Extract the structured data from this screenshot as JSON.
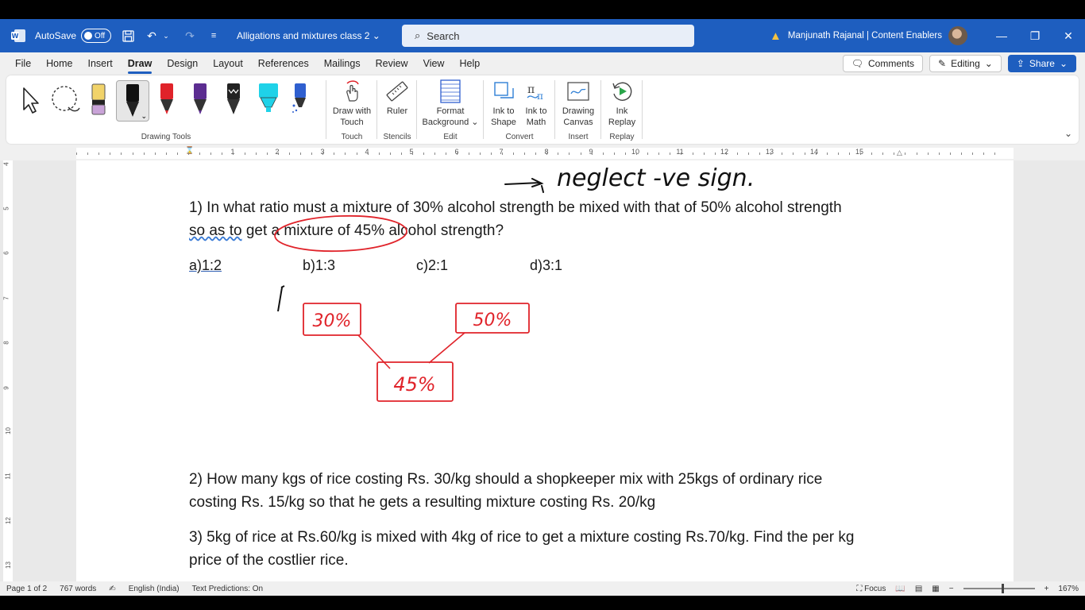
{
  "app": {
    "autosave_label": "AutoSave",
    "autosave_state": "Off",
    "doc_title": "Alligations and mixtures class 2",
    "search_placeholder": "Search",
    "user_name": "Manjunath Rajanal | Content Enablers"
  },
  "menu": {
    "items": [
      "File",
      "Home",
      "Insert",
      "Draw",
      "Design",
      "Layout",
      "References",
      "Mailings",
      "Review",
      "View",
      "Help"
    ],
    "active": "Draw",
    "comments_label": "Comments",
    "editing_label": "Editing",
    "share_label": "Share"
  },
  "ribbon": {
    "groups": {
      "drawing_tools": "Drawing Tools",
      "touch": "Touch",
      "stencils": "Stencils",
      "edit": "Edit",
      "convert": "Convert",
      "insert": "Insert",
      "replay": "Replay"
    },
    "buttons": {
      "draw_with_touch_1": "Draw with",
      "draw_with_touch_2": "Touch",
      "ruler": "Ruler",
      "format_bg_1": "Format",
      "format_bg_2": "Background",
      "ink_to_shape_1": "Ink to",
      "ink_to_shape_2": "Shape",
      "ink_to_math_1": "Ink to",
      "ink_to_math_2": "Math",
      "drawing_canvas_1": "Drawing",
      "drawing_canvas_2": "Canvas",
      "ink_replay_1": "Ink",
      "ink_replay_2": "Replay"
    },
    "pen_colors": [
      "#e0232a",
      "#5c2d91",
      "#222222",
      "#1fd2e8",
      "#2f5fcf"
    ]
  },
  "ruler": {
    "numbers": [
      "1",
      "2",
      "3",
      "4",
      "5",
      "6",
      "7",
      "8",
      "9",
      "10",
      "11",
      "12",
      "13",
      "14",
      "15"
    ],
    "vertical_numbers": [
      "4",
      "5",
      "6",
      "7",
      "8",
      "9",
      "10",
      "11",
      "12",
      "13"
    ]
  },
  "document": {
    "q1_line1": "1) In what ratio must a mixture of 30% alcohol strength be mixed with that of 50% alcohol strength",
    "q1_line2_a": "so as to",
    "q1_line2_b": " get a mixture of 45% alcohol strength?",
    "options": [
      "a)1:2",
      "b)1:3",
      "c)2:1",
      "d)3:1"
    ],
    "q2_line1": "2) How many kgs of rice costing Rs. 30/kg should a shopkeeper mix with 25kgs of ordinary rice",
    "q2_line2": "costing Rs. 15/kg so that he gets a resulting mixture costing Rs. 20/kg",
    "q3_line1": "3) 5kg of rice at Rs.60/kg is mixed with 4kg of rice to get a mixture costing Rs.70/kg. Find the per kg",
    "q3_line2": "price of the costlier rice.",
    "handwriting_top": "neglect -ve sign.",
    "box_left": "30%",
    "box_right": "50%",
    "box_bottom": "45%",
    "ink_color": "#e0232a"
  },
  "status": {
    "page": "Page 1 of 2",
    "words": "767 words",
    "language": "English (India)",
    "predictions": "Text Predictions: On",
    "focus": "Focus",
    "zoom": "167%"
  }
}
